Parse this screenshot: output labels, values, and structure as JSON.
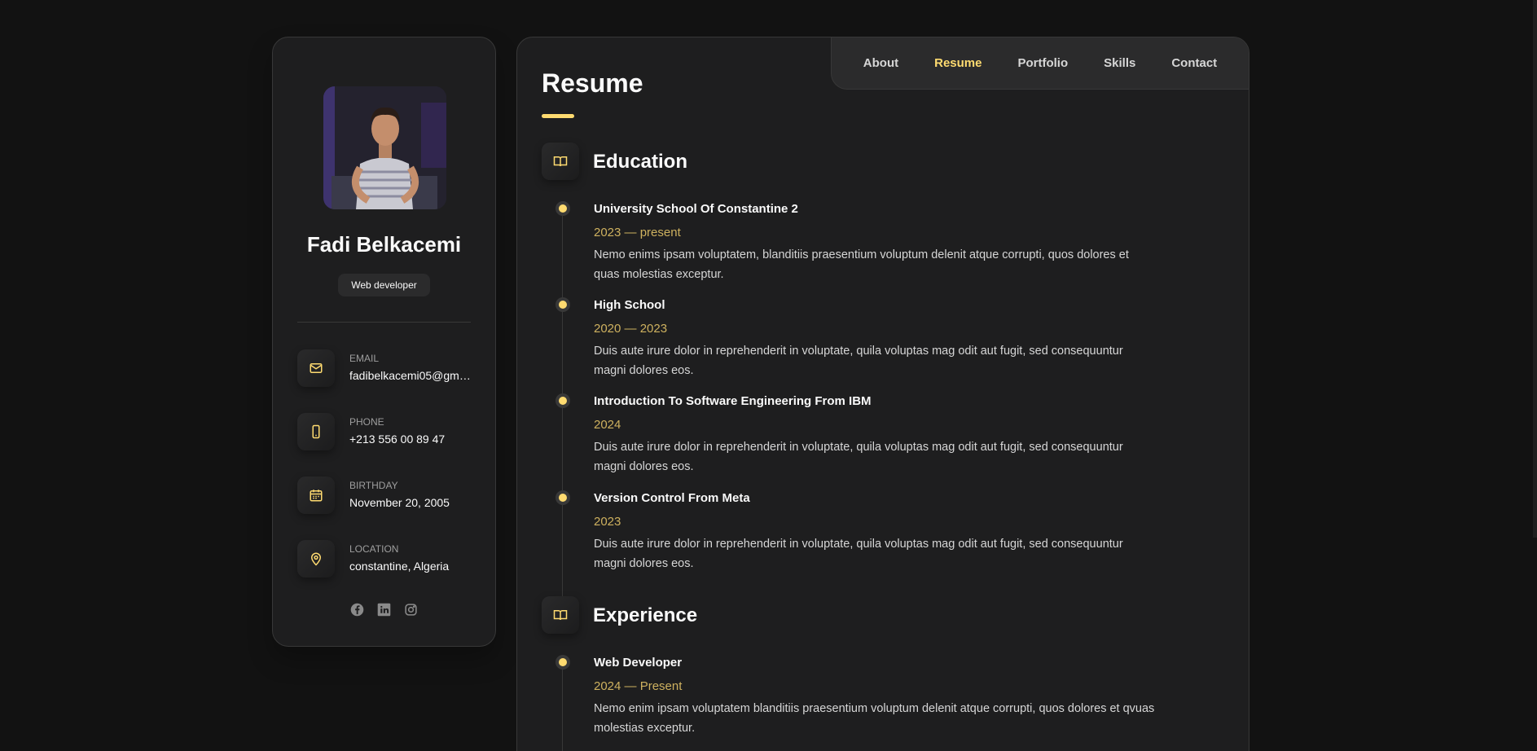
{
  "colors": {
    "accent": "#ffdb70",
    "background": "#121212",
    "card": "#1e1e1f"
  },
  "profile": {
    "name": "Fadi Belkacemi",
    "role": "Web developer"
  },
  "contacts": [
    {
      "label": "EMAIL",
      "value": "fadibelkacemi05@gmai...",
      "icon": "mail-icon"
    },
    {
      "label": "PHONE",
      "value": "+213 556 00 89 47",
      "icon": "phone-icon"
    },
    {
      "label": "BIRTHDAY",
      "value": "November 20, 2005",
      "icon": "calendar-icon"
    },
    {
      "label": "LOCATION",
      "value": "constantine, Algeria",
      "icon": "location-pin-icon"
    }
  ],
  "socials": [
    "facebook-icon",
    "linkedin-icon",
    "instagram-icon"
  ],
  "nav": {
    "items": [
      "About",
      "Resume",
      "Portfolio",
      "Skills",
      "Contact"
    ],
    "active": "Resume"
  },
  "page_title": "Resume",
  "education": {
    "title": "Education",
    "icon": "book-icon",
    "items": [
      {
        "title": "University School Of Constantine 2",
        "date": "2023 — present",
        "text": "Nemo enims ipsam voluptatem, blanditiis praesentium voluptum delenit atque corrupti, quos dolores et quas molestias exceptur."
      },
      {
        "title": "High School",
        "date": "2020 — 2023",
        "text": "Duis aute irure dolor in reprehenderit in voluptate, quila voluptas mag odit aut fugit, sed consequuntur magni dolores eos."
      },
      {
        "title": "Introduction To Software Engineering From IBM",
        "date": "2024",
        "text": "Duis aute irure dolor in reprehenderit in voluptate, quila voluptas mag odit aut fugit, sed consequuntur magni dolores eos."
      },
      {
        "title": "Version Control From Meta",
        "date": "2023",
        "text": "Duis aute irure dolor in reprehenderit in voluptate, quila voluptas mag odit aut fugit, sed consequuntur magni dolores eos."
      }
    ]
  },
  "experience": {
    "title": "Experience",
    "icon": "book-icon",
    "items": [
      {
        "title": "Web Developer",
        "date": "2024 — Present",
        "text": "Nemo enim ipsam voluptatem blanditiis praesentium voluptum delenit atque corrupti, quos dolores et qvuas molestias exceptur."
      }
    ]
  }
}
